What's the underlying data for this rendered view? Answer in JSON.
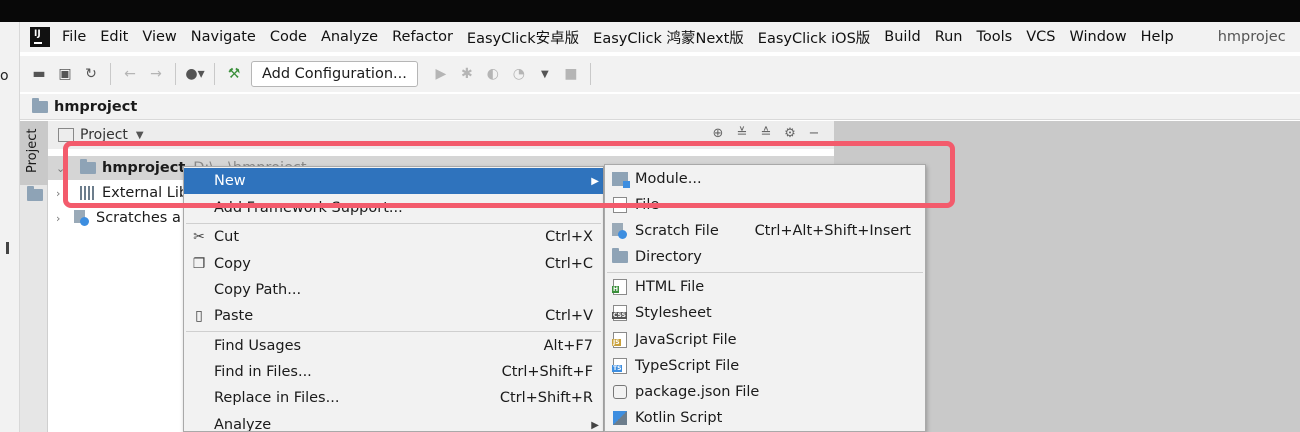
{
  "window": {
    "title": "hmproject"
  },
  "menubar": {
    "items": [
      {
        "label": "File"
      },
      {
        "label": "Edit"
      },
      {
        "label": "View"
      },
      {
        "label": "Navigate"
      },
      {
        "label": "Code"
      },
      {
        "label": "Analyze"
      },
      {
        "label": "Refactor"
      },
      {
        "label": "EasyClick安卓版"
      },
      {
        "label": "EasyClick 鸿蒙Next版"
      },
      {
        "label": "EasyClick iOS版"
      },
      {
        "label": "Build"
      },
      {
        "label": "Run"
      },
      {
        "label": "Tools"
      },
      {
        "label": "VCS"
      },
      {
        "label": "Window"
      },
      {
        "label": "Help"
      }
    ],
    "window_title": "hmprojec"
  },
  "toolbar": {
    "config_label": "Add Configuration..."
  },
  "breadcrumb": {
    "project": "hmproject"
  },
  "side_strip": {
    "tab_label": "Project"
  },
  "project_panel": {
    "view_label": "Project",
    "tree": [
      {
        "label": "hmproject",
        "path": "D:\\...\\hmproject"
      },
      {
        "label": "External Lib"
      },
      {
        "label": "Scratches a"
      }
    ]
  },
  "context_menu": {
    "items": [
      {
        "label": "New",
        "shortcut": ""
      },
      {
        "label": "Add Framework Support...",
        "shortcut": ""
      },
      {
        "label": "Cut",
        "shortcut": "Ctrl+X"
      },
      {
        "label": "Copy",
        "shortcut": "Ctrl+C"
      },
      {
        "label": "Copy Path...",
        "shortcut": ""
      },
      {
        "label": "Paste",
        "shortcut": "Ctrl+V"
      },
      {
        "label": "Find Usages",
        "shortcut": "Alt+F7"
      },
      {
        "label": "Find in Files...",
        "shortcut": "Ctrl+Shift+F"
      },
      {
        "label": "Replace in Files...",
        "shortcut": "Ctrl+Shift+R"
      },
      {
        "label": "Analyze",
        "shortcut": ""
      }
    ]
  },
  "new_submenu": {
    "items": [
      {
        "label": "Module...",
        "shortcut": ""
      },
      {
        "label": "File",
        "shortcut": ""
      },
      {
        "label": "Scratch File",
        "shortcut": "Ctrl+Alt+Shift+Insert"
      },
      {
        "label": "Directory",
        "shortcut": ""
      },
      {
        "label": "HTML File",
        "shortcut": ""
      },
      {
        "label": "Stylesheet",
        "shortcut": ""
      },
      {
        "label": "JavaScript File",
        "shortcut": ""
      },
      {
        "label": "TypeScript File",
        "shortcut": ""
      },
      {
        "label": "package.json File",
        "shortcut": ""
      },
      {
        "label": "Kotlin Script",
        "shortcut": ""
      }
    ]
  },
  "colors": {
    "highlight": "#2f73bd",
    "annotation": "#f35b6c",
    "menu_bg": "#f2f2f2"
  }
}
